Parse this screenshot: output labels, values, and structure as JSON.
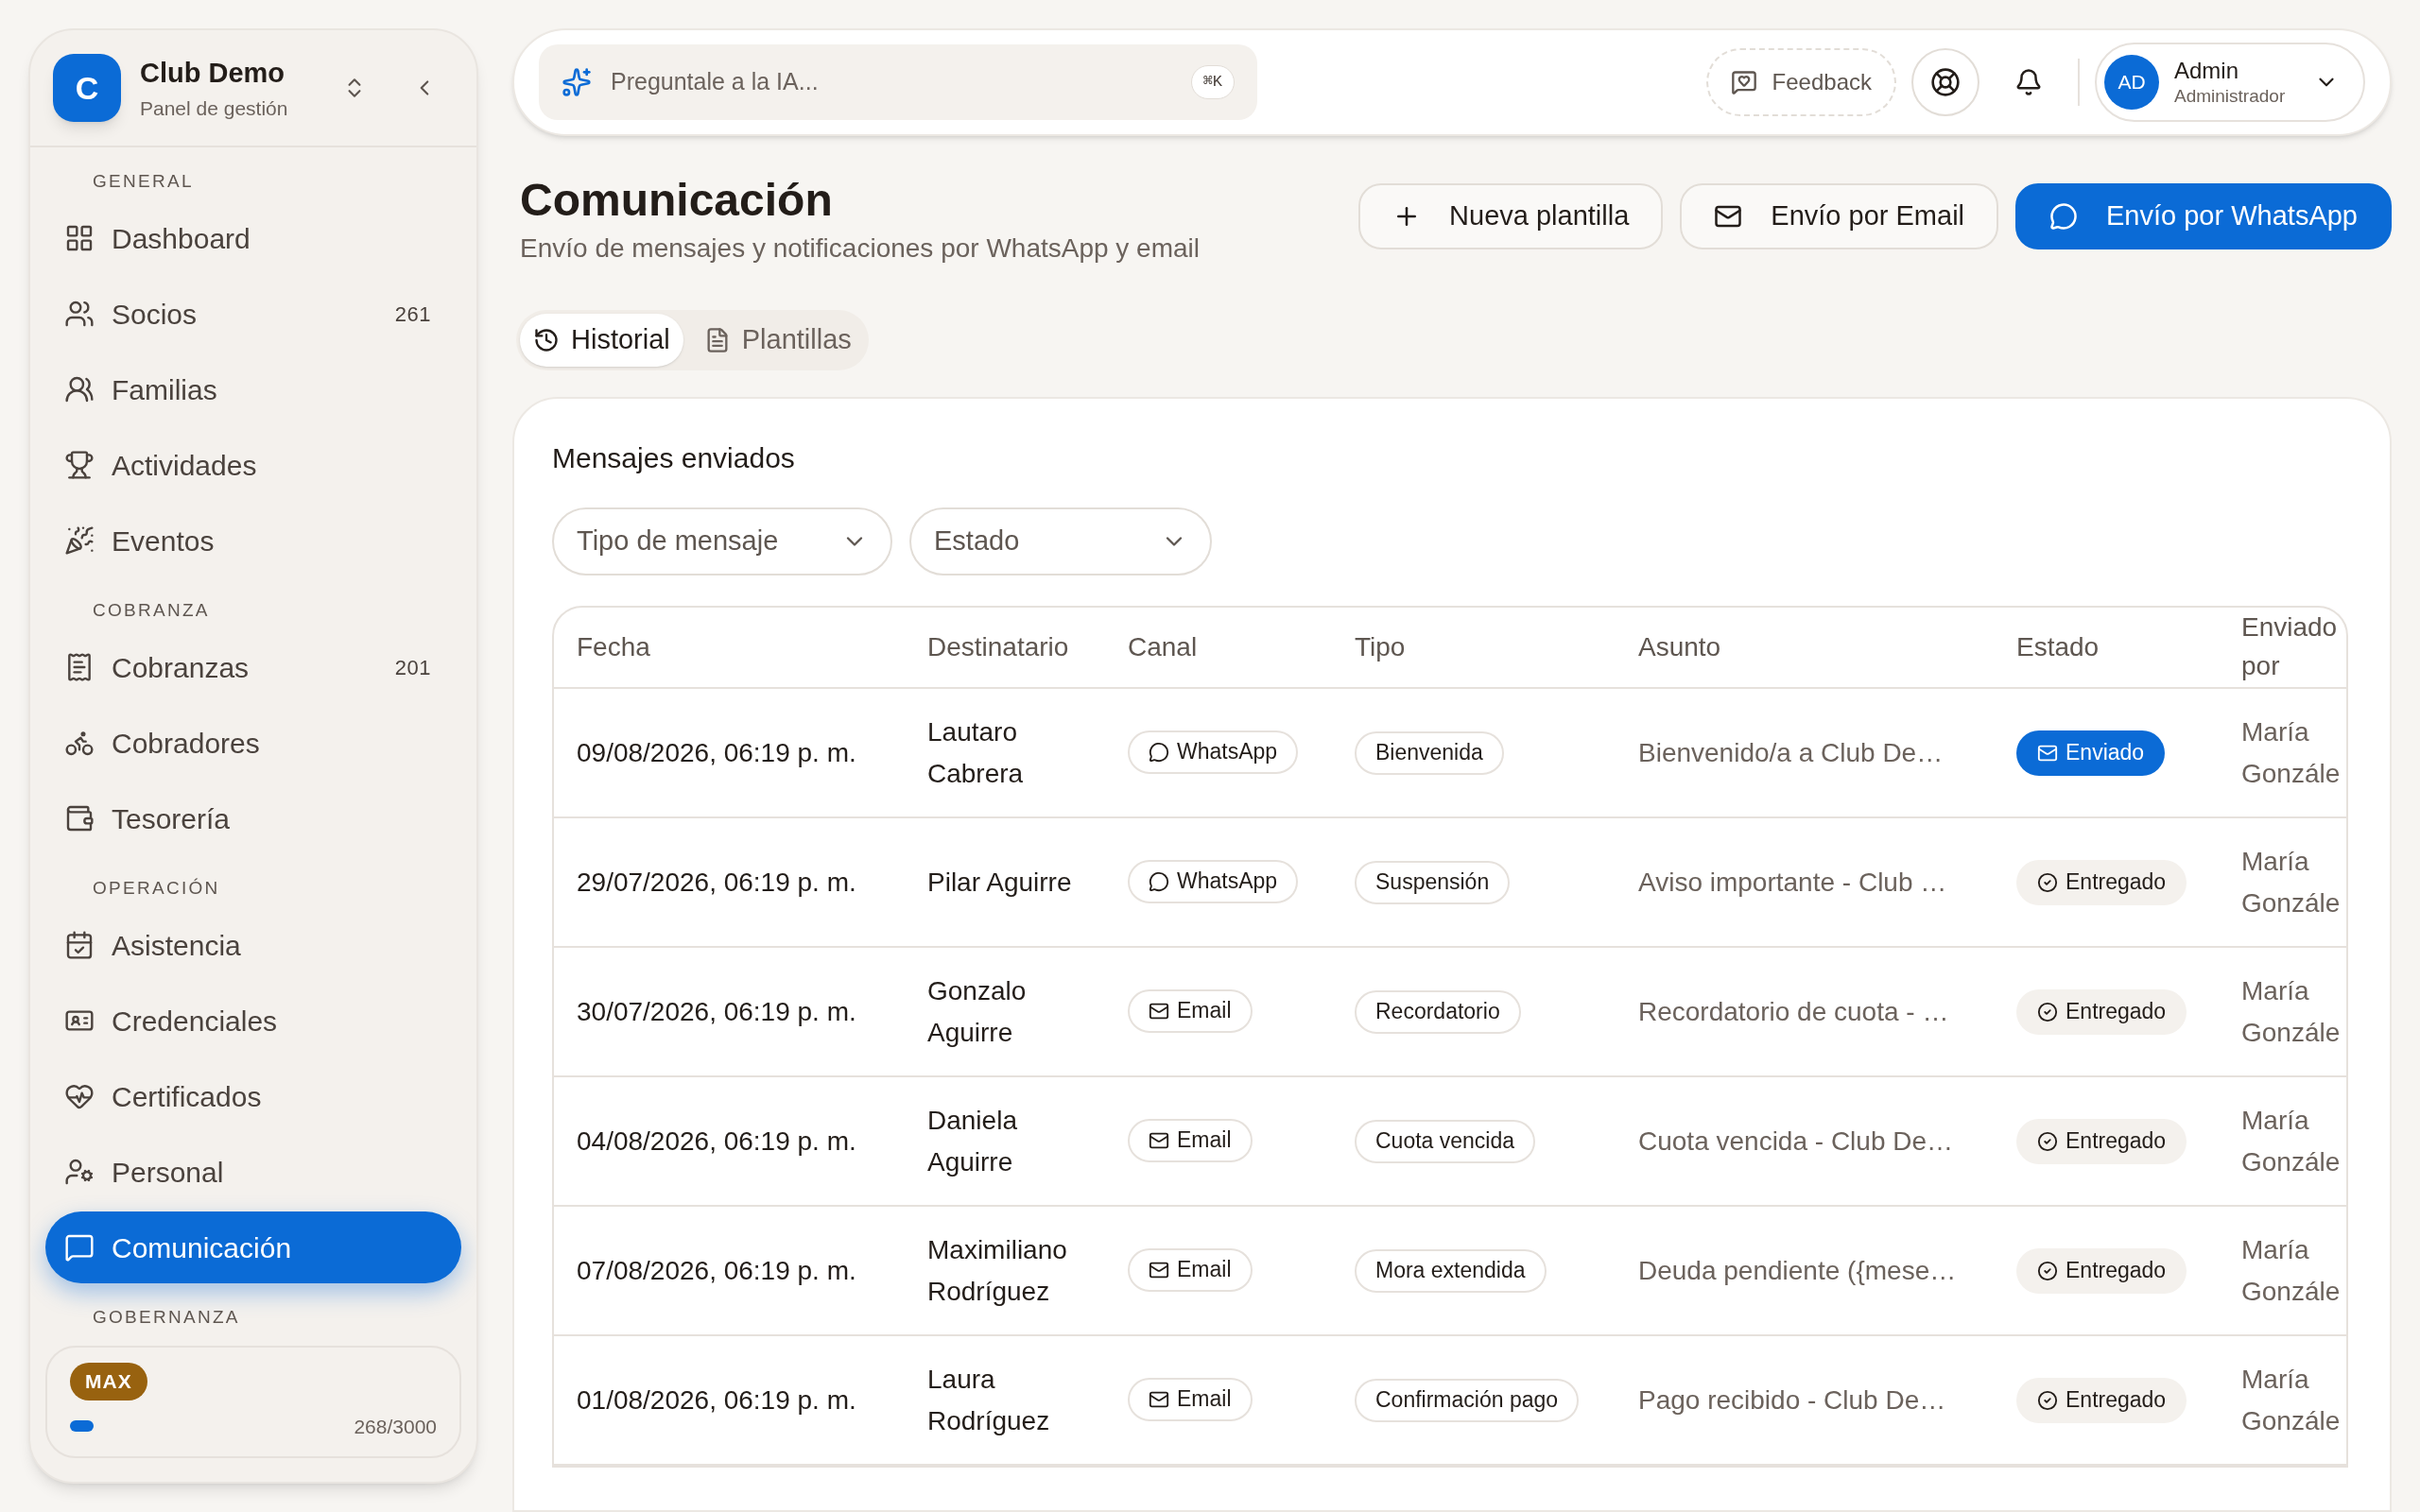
{
  "sidebar": {
    "brand": {
      "initial": "C",
      "name": "Club Demo",
      "subtitle": "Panel de gestión"
    },
    "sections": [
      {
        "title": "GENERAL",
        "items": [
          {
            "label": "Dashboard",
            "selected": false
          },
          {
            "label": "Socios",
            "badge": "261",
            "selected": false
          },
          {
            "label": "Familias",
            "selected": false
          },
          {
            "label": "Actividades",
            "selected": false
          },
          {
            "label": "Eventos",
            "selected": false
          }
        ]
      },
      {
        "title": "COBRANZA",
        "items": [
          {
            "label": "Cobranzas",
            "badge": "201",
            "selected": false
          },
          {
            "label": "Cobradores",
            "selected": false
          },
          {
            "label": "Tesorería",
            "selected": false
          }
        ]
      },
      {
        "title": "OPERACIÓN",
        "items": [
          {
            "label": "Asistencia",
            "selected": false
          },
          {
            "label": "Credenciales",
            "selected": false
          },
          {
            "label": "Certificados",
            "selected": false
          },
          {
            "label": "Personal",
            "selected": false
          },
          {
            "label": "Comunicación",
            "selected": true
          }
        ]
      },
      {
        "title": "GOBERNANZA"
      }
    ],
    "plan": {
      "badge": "MAX",
      "usage": "268/3000",
      "level": 0.09
    }
  },
  "topbar": {
    "search": {
      "placeholder": "Preguntale a la IA...",
      "shortcut": "⌘K"
    },
    "feedback": "Feedback",
    "user": {
      "initials": "AD",
      "name": "Admin",
      "role": "Administrador"
    }
  },
  "page": {
    "title": "Comunicación",
    "subtitle": "Envío de mensajes y notificaciones por WhatsApp y email",
    "actions": [
      {
        "label": "Nueva plantilla",
        "kind": "add"
      },
      {
        "label": "Envío por Email",
        "kind": "email"
      },
      {
        "label": "Envío por WhatsApp",
        "kind": "whatsapp"
      }
    ],
    "tabs": [
      {
        "label": "Historial",
        "selected": true
      },
      {
        "label": "Plantillas",
        "selected": false
      }
    ]
  },
  "card": {
    "title": "Mensajes enviados",
    "filters": [
      {
        "label": "Tipo de mensaje"
      },
      {
        "label": "Estado"
      }
    ],
    "table": {
      "columns": [
        "Fecha",
        "Destinatario",
        "Canal",
        "Tipo",
        "Asunto",
        "Estado",
        "Enviado por"
      ],
      "rows": [
        {
          "fecha": "09/08/2026, 06:19 p. m.",
          "destinatario": "Lautaro Cabrera",
          "canal": {
            "label": "WhatsApp",
            "kind": "whatsapp"
          },
          "tipo": "Bienvenida",
          "asunto": "Bienvenido/a a Club De…",
          "estado": {
            "label": "Enviado",
            "kind": "sent"
          },
          "enviado_por": "María Gonzále"
        },
        {
          "fecha": "29/07/2026, 06:19 p. m.",
          "destinatario": "Pilar Aguirre",
          "canal": {
            "label": "WhatsApp",
            "kind": "whatsapp"
          },
          "tipo": "Suspensión",
          "asunto": "Aviso importante - Club …",
          "estado": {
            "label": "Entregado",
            "kind": "delivered"
          },
          "enviado_por": "María Gonzále"
        },
        {
          "fecha": "30/07/2026, 06:19 p. m.",
          "destinatario": "Gonzalo Aguirre",
          "canal": {
            "label": "Email",
            "kind": "email"
          },
          "tipo": "Recordatorio",
          "asunto": "Recordatorio de cuota - …",
          "estado": {
            "label": "Entregado",
            "kind": "delivered"
          },
          "enviado_por": "María Gonzále"
        },
        {
          "fecha": "04/08/2026, 06:19 p. m.",
          "destinatario": "Daniela Aguirre",
          "canal": {
            "label": "Email",
            "kind": "email"
          },
          "tipo": "Cuota vencida",
          "asunto": "Cuota vencida - Club De…",
          "estado": {
            "label": "Entregado",
            "kind": "delivered"
          },
          "enviado_por": "María Gonzále"
        },
        {
          "fecha": "07/08/2026, 06:19 p. m.",
          "destinatario": "Maximiliano Rodríguez",
          "canal": {
            "label": "Email",
            "kind": "email"
          },
          "tipo": "Mora extendida",
          "asunto": "Deuda pendiente ({mese…",
          "estado": {
            "label": "Entregado",
            "kind": "delivered"
          },
          "enviado_por": "María Gonzále"
        },
        {
          "fecha": "01/08/2026, 06:19 p. m.",
          "destinatario": "Laura Rodríguez",
          "canal": {
            "label": "Email",
            "kind": "email"
          },
          "tipo": "Confirmación pago",
          "asunto": "Pago recibido - Club De…",
          "estado": {
            "label": "Entregado",
            "kind": "delivered"
          },
          "enviado_por": "María Gonzále"
        }
      ]
    }
  }
}
